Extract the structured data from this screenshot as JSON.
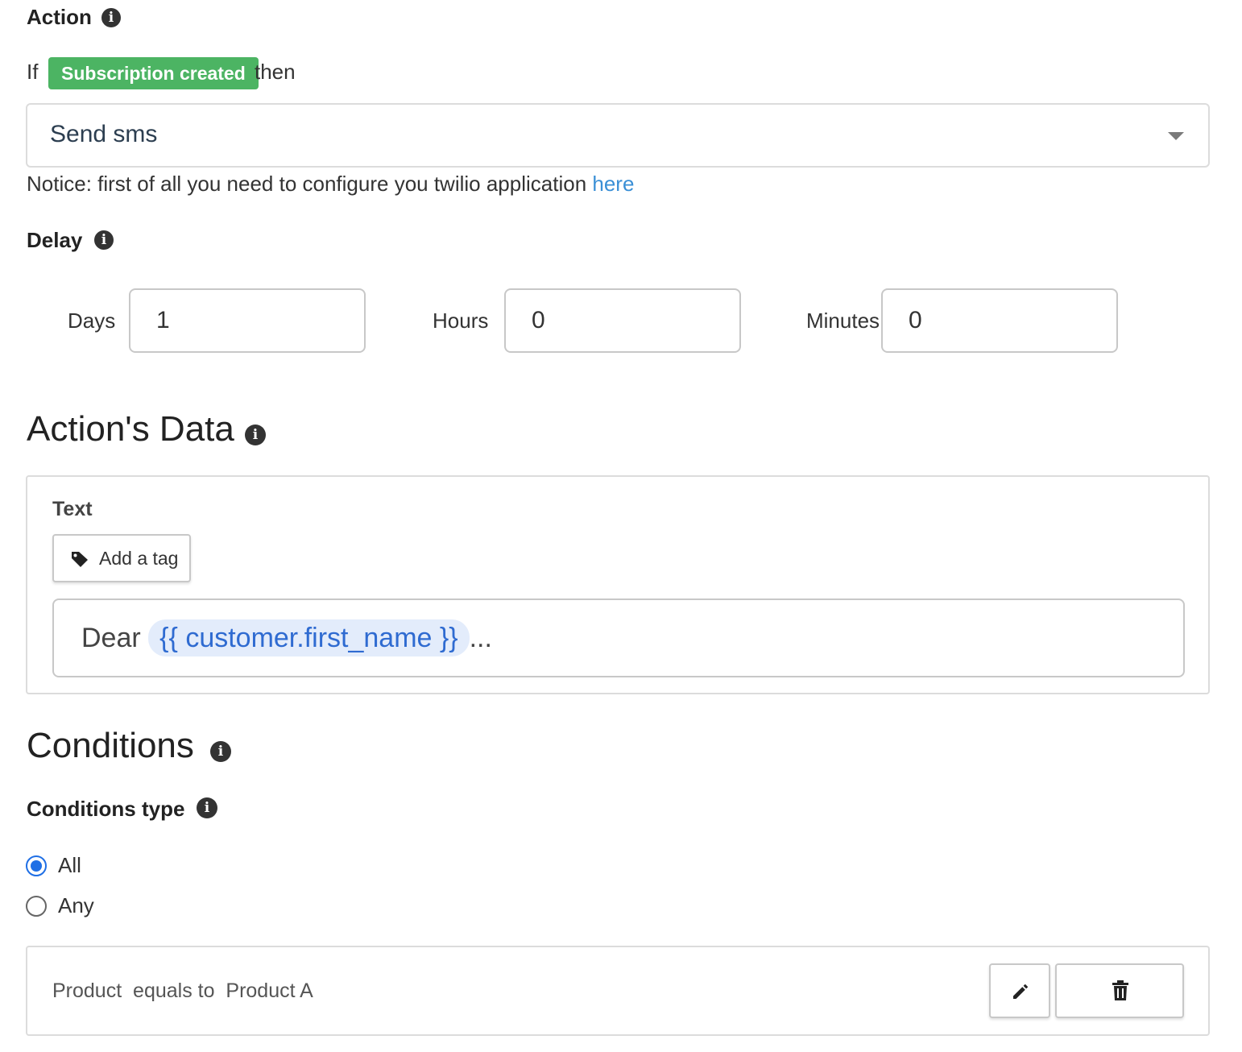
{
  "action": {
    "label": "Action",
    "if_text": "If",
    "trigger": "Subscription created",
    "then_text": "then",
    "selected_action": "Send sms",
    "notice_text": "Notice: first of all you need to configure you twilio application ",
    "notice_link": "here"
  },
  "delay": {
    "label": "Delay",
    "days_label": "Days",
    "days_value": "1",
    "hours_label": "Hours",
    "hours_value": "0",
    "minutes_label": "Minutes",
    "minutes_value": "0"
  },
  "actions_data": {
    "title": "Action's Data",
    "text_label": "Text",
    "add_tag_label": "Add a tag",
    "message_prefix": "Dear",
    "message_token": "{{ customer.first_name }}",
    "message_suffix": "..."
  },
  "conditions": {
    "title": "Conditions",
    "type_label": "Conditions type",
    "options": [
      "All",
      "Any"
    ],
    "selected": "All",
    "rule_text": "Product  equals to  Product A"
  },
  "icons": {
    "info": "info-icon",
    "tag": "tag-icon",
    "edit": "pencil-icon",
    "delete": "trash-icon",
    "dropdown": "caret-down-icon"
  },
  "colors": {
    "trigger_pill": "#4cb463",
    "link": "#3a8fd6",
    "radio_checked": "#1f6fe5",
    "token_bg": "#e3ecfb",
    "token_text": "#2f6bd1"
  }
}
